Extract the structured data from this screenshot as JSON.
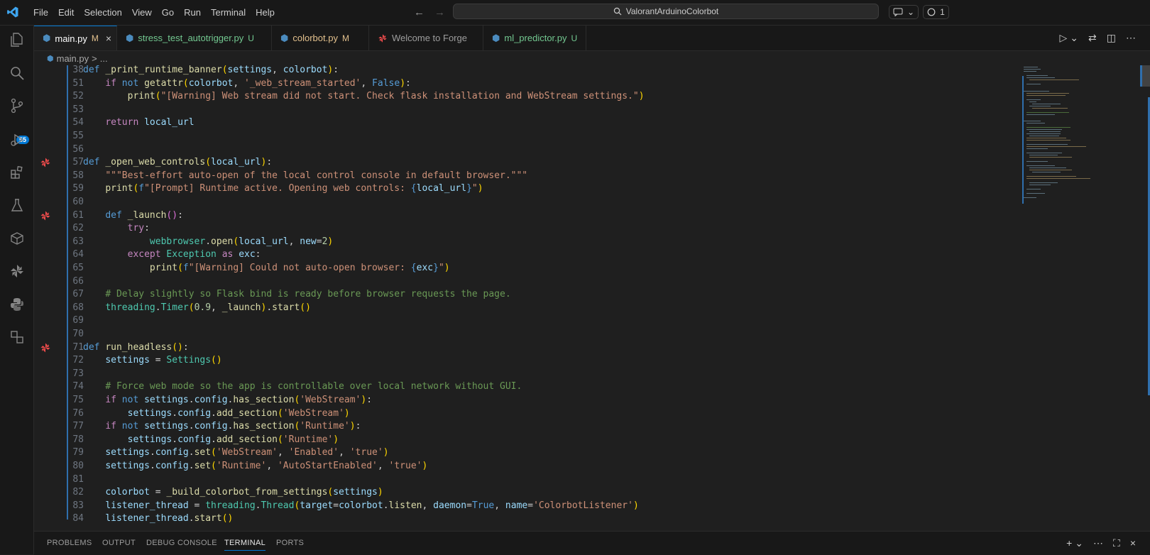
{
  "menu": [
    "File",
    "Edit",
    "Selection",
    "View",
    "Go",
    "Run",
    "Terminal",
    "Help"
  ],
  "search": {
    "text": "ValorantArduinoColorbot"
  },
  "title_right": {
    "notifications": "1"
  },
  "activity": {
    "scm_badge": "55"
  },
  "tabs": [
    {
      "label": "main.py",
      "status": "M"
    },
    {
      "label": "stress_test_autotrigger.py",
      "status": "U"
    },
    {
      "label": "colorbot.py",
      "status": "M"
    },
    {
      "label": "Welcome to Forge",
      "status": ""
    },
    {
      "label": "ml_predictor.py",
      "status": "U"
    }
  ],
  "breadcrumb": {
    "file": "main.py",
    "sep": ">",
    "more": "..."
  },
  "lines": [
    {
      "n": "38",
      "tokens": [
        [
          "kw",
          "def "
        ],
        [
          "fn",
          "_print_runtime_banner"
        ],
        [
          "br1",
          "("
        ],
        [
          "var",
          "settings"
        ],
        [
          "",
          ","
        ],
        [
          "var",
          " colorbot"
        ],
        [
          "br1",
          ")"
        ],
        [
          "",
          ":"
        ]
      ]
    },
    {
      "n": "51",
      "tokens": [
        [
          "",
          "    "
        ],
        [
          "ctl",
          "if "
        ],
        [
          "kw",
          "not "
        ],
        [
          "fn",
          "getattr"
        ],
        [
          "br1",
          "("
        ],
        [
          "var",
          "colorbot"
        ],
        [
          "",
          ", "
        ],
        [
          "str",
          "'_web_stream_started'"
        ],
        [
          "",
          ", "
        ],
        [
          "kw",
          "False"
        ],
        [
          "br1",
          ")"
        ],
        [
          "",
          ":"
        ]
      ]
    },
    {
      "n": "52",
      "tokens": [
        [
          "",
          "        "
        ],
        [
          "fn",
          "print"
        ],
        [
          "br1",
          "("
        ],
        [
          "str",
          "\"[Warning] Web stream did not start. Check flask installation and WebStream settings.\""
        ],
        [
          "br1",
          ")"
        ]
      ]
    },
    {
      "n": "53",
      "tokens": []
    },
    {
      "n": "54",
      "tokens": [
        [
          "",
          "    "
        ],
        [
          "ctl",
          "return "
        ],
        [
          "var",
          "local_url"
        ]
      ]
    },
    {
      "n": "55",
      "tokens": []
    },
    {
      "n": "56",
      "tokens": []
    },
    {
      "n": "57",
      "tokens": [
        [
          "kw",
          "def "
        ],
        [
          "fn",
          "_open_web_controls"
        ],
        [
          "br1",
          "("
        ],
        [
          "var",
          "local_url"
        ],
        [
          "br1",
          ")"
        ],
        [
          "",
          ":"
        ]
      ],
      "glyph": true
    },
    {
      "n": "58",
      "tokens": [
        [
          "",
          "    "
        ],
        [
          "str",
          "\"\"\"Best-effort auto-open of the local control console in default browser.\"\"\""
        ]
      ]
    },
    {
      "n": "59",
      "tokens": [
        [
          "",
          "    "
        ],
        [
          "fn",
          "print"
        ],
        [
          "br1",
          "("
        ],
        [
          "kw",
          "f"
        ],
        [
          "str",
          "\"[Prompt] Runtime active. Opening web controls: "
        ],
        [
          "kw",
          "{"
        ],
        [
          "var",
          "local_url"
        ],
        [
          "kw",
          "}"
        ],
        [
          "str",
          "\""
        ],
        [
          "br1",
          ")"
        ]
      ]
    },
    {
      "n": "60",
      "tokens": []
    },
    {
      "n": "61",
      "tokens": [
        [
          "",
          "    "
        ],
        [
          "kw",
          "def "
        ],
        [
          "fn",
          "_launch"
        ],
        [
          "br2",
          "()"
        ],
        [
          "",
          ":"
        ]
      ],
      "glyph": true
    },
    {
      "n": "62",
      "tokens": [
        [
          "",
          "        "
        ],
        [
          "ctl",
          "try"
        ],
        [
          "",
          ":"
        ]
      ]
    },
    {
      "n": "63",
      "tokens": [
        [
          "",
          "            "
        ],
        [
          "cls",
          "webbrowser"
        ],
        [
          "",
          "."
        ],
        [
          "fn",
          "open"
        ],
        [
          "br1",
          "("
        ],
        [
          "var",
          "local_url"
        ],
        [
          "",
          ", "
        ],
        [
          "var",
          "new"
        ],
        [
          "",
          "="
        ],
        [
          "num",
          "2"
        ],
        [
          "br1",
          ")"
        ]
      ]
    },
    {
      "n": "64",
      "tokens": [
        [
          "",
          "        "
        ],
        [
          "ctl",
          "except "
        ],
        [
          "cls",
          "Exception "
        ],
        [
          "ctl",
          "as "
        ],
        [
          "var",
          "exc"
        ],
        [
          "",
          ":"
        ]
      ]
    },
    {
      "n": "65",
      "tokens": [
        [
          "",
          "            "
        ],
        [
          "fn",
          "print"
        ],
        [
          "br1",
          "("
        ],
        [
          "kw",
          "f"
        ],
        [
          "str",
          "\"[Warning] Could not auto-open browser: "
        ],
        [
          "kw",
          "{"
        ],
        [
          "var",
          "exc"
        ],
        [
          "kw",
          "}"
        ],
        [
          "str",
          "\""
        ],
        [
          "br1",
          ")"
        ]
      ]
    },
    {
      "n": "66",
      "tokens": []
    },
    {
      "n": "67",
      "tokens": [
        [
          "",
          "    "
        ],
        [
          "com",
          "# Delay slightly so Flask bind is ready before browser requests the page."
        ]
      ]
    },
    {
      "n": "68",
      "tokens": [
        [
          "",
          "    "
        ],
        [
          "cls",
          "threading"
        ],
        [
          "",
          "."
        ],
        [
          "cls",
          "Timer"
        ],
        [
          "br1",
          "("
        ],
        [
          "num",
          "0.9"
        ],
        [
          "",
          ", "
        ],
        [
          "fn",
          "_launch"
        ],
        [
          "br1",
          ")"
        ],
        [
          "",
          "."
        ],
        [
          "fn",
          "start"
        ],
        [
          "br1",
          "()"
        ]
      ]
    },
    {
      "n": "69",
      "tokens": []
    },
    {
      "n": "70",
      "tokens": []
    },
    {
      "n": "71",
      "tokens": [
        [
          "kw",
          "def "
        ],
        [
          "fn",
          "run_headless"
        ],
        [
          "br1",
          "()"
        ],
        [
          "",
          ":"
        ]
      ],
      "glyph": true
    },
    {
      "n": "72",
      "tokens": [
        [
          "",
          "    "
        ],
        [
          "var",
          "settings"
        ],
        [
          "",
          " = "
        ],
        [
          "cls",
          "Settings"
        ],
        [
          "br1",
          "()"
        ]
      ]
    },
    {
      "n": "73",
      "tokens": []
    },
    {
      "n": "74",
      "tokens": [
        [
          "",
          "    "
        ],
        [
          "com",
          "# Force web mode so the app is controllable over local network without GUI."
        ]
      ]
    },
    {
      "n": "75",
      "tokens": [
        [
          "",
          "    "
        ],
        [
          "ctl",
          "if "
        ],
        [
          "kw",
          "not "
        ],
        [
          "var",
          "settings"
        ],
        [
          "",
          "."
        ],
        [
          "var",
          "config"
        ],
        [
          "",
          "."
        ],
        [
          "fn",
          "has_section"
        ],
        [
          "br1",
          "("
        ],
        [
          "str",
          "'WebStream'"
        ],
        [
          "br1",
          ")"
        ],
        [
          "",
          ":"
        ]
      ]
    },
    {
      "n": "76",
      "tokens": [
        [
          "",
          "        "
        ],
        [
          "var",
          "settings"
        ],
        [
          "",
          "."
        ],
        [
          "var",
          "config"
        ],
        [
          "",
          "."
        ],
        [
          "fn",
          "add_section"
        ],
        [
          "br1",
          "("
        ],
        [
          "str",
          "'WebStream'"
        ],
        [
          "br1",
          ")"
        ]
      ]
    },
    {
      "n": "77",
      "tokens": [
        [
          "",
          "    "
        ],
        [
          "ctl",
          "if "
        ],
        [
          "kw",
          "not "
        ],
        [
          "var",
          "settings"
        ],
        [
          "",
          "."
        ],
        [
          "var",
          "config"
        ],
        [
          "",
          "."
        ],
        [
          "fn",
          "has_section"
        ],
        [
          "br1",
          "("
        ],
        [
          "str",
          "'Runtime'"
        ],
        [
          "br1",
          ")"
        ],
        [
          "",
          ":"
        ]
      ]
    },
    {
      "n": "78",
      "tokens": [
        [
          "",
          "        "
        ],
        [
          "var",
          "settings"
        ],
        [
          "",
          "."
        ],
        [
          "var",
          "config"
        ],
        [
          "",
          "."
        ],
        [
          "fn",
          "add_section"
        ],
        [
          "br1",
          "("
        ],
        [
          "str",
          "'Runtime'"
        ],
        [
          "br1",
          ")"
        ]
      ]
    },
    {
      "n": "79",
      "tokens": [
        [
          "",
          "    "
        ],
        [
          "var",
          "settings"
        ],
        [
          "",
          "."
        ],
        [
          "var",
          "config"
        ],
        [
          "",
          "."
        ],
        [
          "fn",
          "set"
        ],
        [
          "br1",
          "("
        ],
        [
          "str",
          "'WebStream'"
        ],
        [
          "",
          ", "
        ],
        [
          "str",
          "'Enabled'"
        ],
        [
          "",
          ", "
        ],
        [
          "str",
          "'true'"
        ],
        [
          "br1",
          ")"
        ]
      ]
    },
    {
      "n": "80",
      "tokens": [
        [
          "",
          "    "
        ],
        [
          "var",
          "settings"
        ],
        [
          "",
          "."
        ],
        [
          "var",
          "config"
        ],
        [
          "",
          "."
        ],
        [
          "fn",
          "set"
        ],
        [
          "br1",
          "("
        ],
        [
          "str",
          "'Runtime'"
        ],
        [
          "",
          ", "
        ],
        [
          "str",
          "'AutoStartEnabled'"
        ],
        [
          "",
          ", "
        ],
        [
          "str",
          "'true'"
        ],
        [
          "br1",
          ")"
        ]
      ]
    },
    {
      "n": "81",
      "tokens": []
    },
    {
      "n": "82",
      "tokens": [
        [
          "",
          "    "
        ],
        [
          "var",
          "colorbot"
        ],
        [
          "",
          " = "
        ],
        [
          "fn",
          "_build_colorbot_from_settings"
        ],
        [
          "br1",
          "("
        ],
        [
          "var",
          "settings"
        ],
        [
          "br1",
          ")"
        ]
      ]
    },
    {
      "n": "83",
      "tokens": [
        [
          "",
          "    "
        ],
        [
          "var",
          "listener_thread"
        ],
        [
          "",
          " = "
        ],
        [
          "cls",
          "threading"
        ],
        [
          "",
          "."
        ],
        [
          "cls",
          "Thread"
        ],
        [
          "br1",
          "("
        ],
        [
          "var",
          "target"
        ],
        [
          "",
          "="
        ],
        [
          "var",
          "colorbot"
        ],
        [
          "",
          "."
        ],
        [
          "fn",
          "listen"
        ],
        [
          "",
          ", "
        ],
        [
          "var",
          "daemon"
        ],
        [
          "",
          "="
        ],
        [
          "kw",
          "True"
        ],
        [
          "",
          ", "
        ],
        [
          "var",
          "name"
        ],
        [
          "",
          "="
        ],
        [
          "str",
          "'ColorbotListener'"
        ],
        [
          "br1",
          ")"
        ]
      ]
    },
    {
      "n": "84",
      "tokens": [
        [
          "",
          "    "
        ],
        [
          "var",
          "listener_thread"
        ],
        [
          "",
          "."
        ],
        [
          "fn",
          "start"
        ],
        [
          "br1",
          "()"
        ]
      ]
    }
  ],
  "panel_tabs": [
    "PROBLEMS",
    "OUTPUT",
    "DEBUG CONSOLE",
    "TERMINAL",
    "PORTS"
  ],
  "panel_active": "TERMINAL",
  "colors": {
    "accent": "#0078d4",
    "forge": "#f14c4c"
  }
}
